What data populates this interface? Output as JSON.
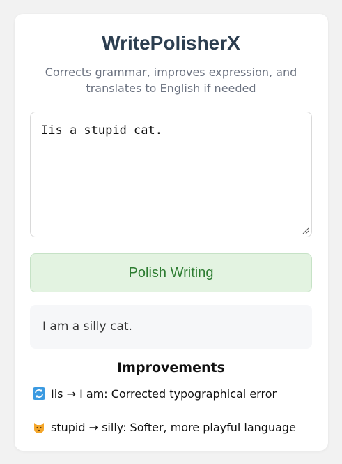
{
  "app": {
    "title": "WritePolisherX",
    "subtitle": "Corrects grammar, improves expression, and translates to English if needed"
  },
  "editor": {
    "value": "Iis a stupid cat."
  },
  "button": {
    "label": "Polish Writing"
  },
  "result": {
    "text": "I am a silly cat."
  },
  "improvements": {
    "title": "Improvements",
    "items": [
      {
        "icon": "repeat-icon",
        "text": "Iis → I am: Corrected typographical error"
      },
      {
        "icon": "cat-face-icon",
        "text": "stupid → silly: Softer, more playful language"
      }
    ]
  },
  "colors": {
    "button_bg": "#e3f3e1",
    "button_text": "#2e7d32",
    "title_text": "#2c3e50"
  }
}
